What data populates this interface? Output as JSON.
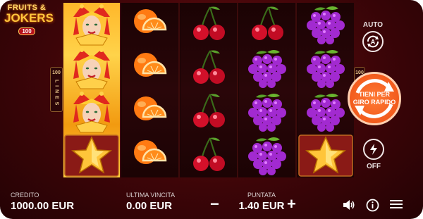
{
  "logo": {
    "line1": "FRUITS &",
    "line2": "JOKERS",
    "badge": "100"
  },
  "lines": {
    "left_number": "100",
    "left_text": "L I N E S",
    "right_number": "100"
  },
  "reels": [
    [
      "joker",
      "joker",
      "joker",
      "star"
    ],
    [
      "orange",
      "orange",
      "orange",
      "orange"
    ],
    [
      "cherry",
      "cherry",
      "cherry",
      "cherry"
    ],
    [
      "cherry",
      "grapes",
      "grapes",
      "grapes"
    ],
    [
      "grapes",
      "grapes",
      "grapes",
      "star"
    ]
  ],
  "controls": {
    "auto_label": "AUTO",
    "spin_line1": "TIENI PER",
    "spin_line2": "GIRO RAPIDO",
    "turbo_state": "OFF"
  },
  "bottom": {
    "credit_label": "CREDITO",
    "credit_value": "1000.00 EUR",
    "last_win_label": "ULTIMA VINCITA",
    "last_win_value": "0.00 EUR",
    "bet_label": "PUNTATA",
    "bet_value": "1.40 EUR",
    "minus": "−",
    "plus": "+"
  },
  "icons": [
    "sound-icon",
    "info-icon",
    "menu-icon"
  ],
  "colors": {
    "background": "#3d0508",
    "spin_button": "#f25b1c",
    "gold": "#ffc63d"
  }
}
